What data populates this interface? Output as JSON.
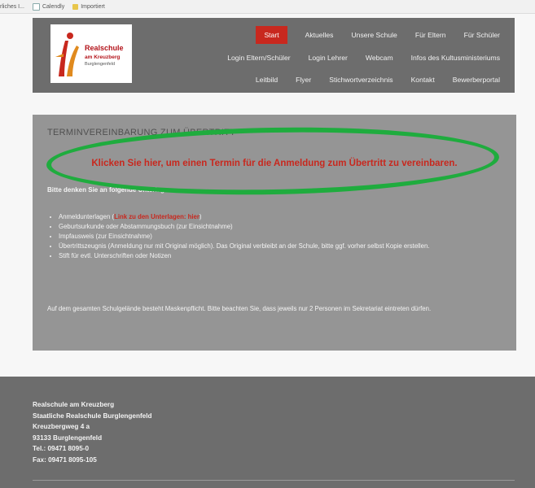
{
  "bookmarks": [
    {
      "label": "rliches I...",
      "icon": ""
    },
    {
      "label": "Calendly",
      "icon": "calendar-icon"
    },
    {
      "label": "Importiert",
      "icon": "folder-icon"
    }
  ],
  "logo": {
    "line1": "Realschule",
    "line2": "am Kreuzberg",
    "line3": "Burglengenfeld"
  },
  "nav": {
    "row1": [
      "Start",
      "Aktuelles",
      "Unsere Schule",
      "Für Eltern",
      "Für Schüler"
    ],
    "row2": [
      "Login Eltern/Schüler",
      "Login Lehrer",
      "Webcam",
      "Infos des Kultusministeriums"
    ],
    "row3": [
      "Leitbild",
      "Flyer",
      "Stichwortverzeichnis",
      "Kontakt",
      "Bewerberportal"
    ],
    "active": "Start"
  },
  "content": {
    "title": "TERMINVEREINBARUNG ZUM ÜBERTRITT",
    "headline": "Klicken Sie hier, um einen Termin für die Anmeldung zum Übertritt zu vereinbaren.",
    "intro": "Bitte denken Sie an folgende Unterlagen:",
    "list": {
      "item1_prefix": "Anmeldunterlagen (",
      "item1_link": "Link zu den Unterlagen: hier",
      "item1_suffix": ")",
      "item2": "Geburtsurkunde oder Abstammungsbuch (zur Einsichtnahme)",
      "item3": "Impfausweis (zur Einsichtnahme)",
      "item4": "Übertrittszeugnis (Anmeldung nur mit Original möglich). Das Original verbleibt an der Schule, bitte ggf. vorher selbst Kopie erstellen.",
      "item5": "Stift für evtl. Unterschriften oder Notizen"
    },
    "note": "Auf dem gesamten Schulgelände besteht Maskenpflicht. Bitte beachten Sie, dass jeweils nur 2 Personen im Sekretariat eintreten dürfen."
  },
  "footer": {
    "lines": [
      "Realschule am Kreuzberg",
      "Staatliche Realschule Burglengenfeld",
      "Kreuzbergweg 4 a",
      "93133 Burglengenfeld",
      "Tel.: 09471 8095-0",
      "Fax: 09471 8095-105"
    ]
  },
  "colors": {
    "accent": "#c8281e",
    "header_bg": "#6d6d6d",
    "content_bg": "#959595",
    "annotation": "#1fac3e"
  }
}
